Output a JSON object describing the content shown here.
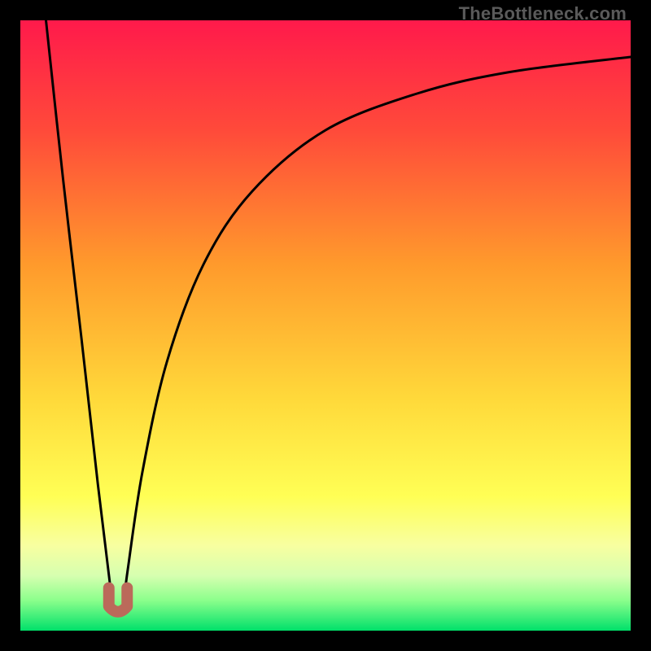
{
  "watermark": "TheBottleneck.com",
  "chart_data": {
    "type": "line",
    "title": "",
    "xlabel": "",
    "ylabel": "",
    "xlim": [
      0,
      100
    ],
    "ylim": [
      0,
      100
    ],
    "grid": false,
    "legend": false,
    "background_gradient_stops": [
      {
        "pct": 0,
        "color": "#ff1a4b"
      },
      {
        "pct": 18,
        "color": "#ff4a3a"
      },
      {
        "pct": 40,
        "color": "#ff9a2c"
      },
      {
        "pct": 62,
        "color": "#ffd93a"
      },
      {
        "pct": 78,
        "color": "#ffff55"
      },
      {
        "pct": 86,
        "color": "#f8ffa0"
      },
      {
        "pct": 91,
        "color": "#d6ffb0"
      },
      {
        "pct": 95,
        "color": "#8cff8c"
      },
      {
        "pct": 100,
        "color": "#00e06a"
      }
    ],
    "series": [
      {
        "name": "bottleneck-curve",
        "color": "#000000",
        "x_optimum": 16,
        "dip_y": 4,
        "points": [
          {
            "x": 4.2,
            "y": 100
          },
          {
            "x": 7,
            "y": 74
          },
          {
            "x": 10,
            "y": 48
          },
          {
            "x": 12.7,
            "y": 24
          },
          {
            "x": 14.4,
            "y": 10
          },
          {
            "x": 15.2,
            "y": 4
          },
          {
            "x": 16.0,
            "y": 3.3
          },
          {
            "x": 16.8,
            "y": 4
          },
          {
            "x": 17.6,
            "y": 10
          },
          {
            "x": 20,
            "y": 26
          },
          {
            "x": 24,
            "y": 44
          },
          {
            "x": 30,
            "y": 60
          },
          {
            "x": 38,
            "y": 72
          },
          {
            "x": 50,
            "y": 82
          },
          {
            "x": 65,
            "y": 88
          },
          {
            "x": 80,
            "y": 91.5
          },
          {
            "x": 100,
            "y": 94
          }
        ]
      },
      {
        "name": "dip-marker",
        "color": "#bb6a5a",
        "shape": "u",
        "x": 16,
        "y": 4,
        "width_pct": 3,
        "height_pct": 3
      }
    ]
  }
}
